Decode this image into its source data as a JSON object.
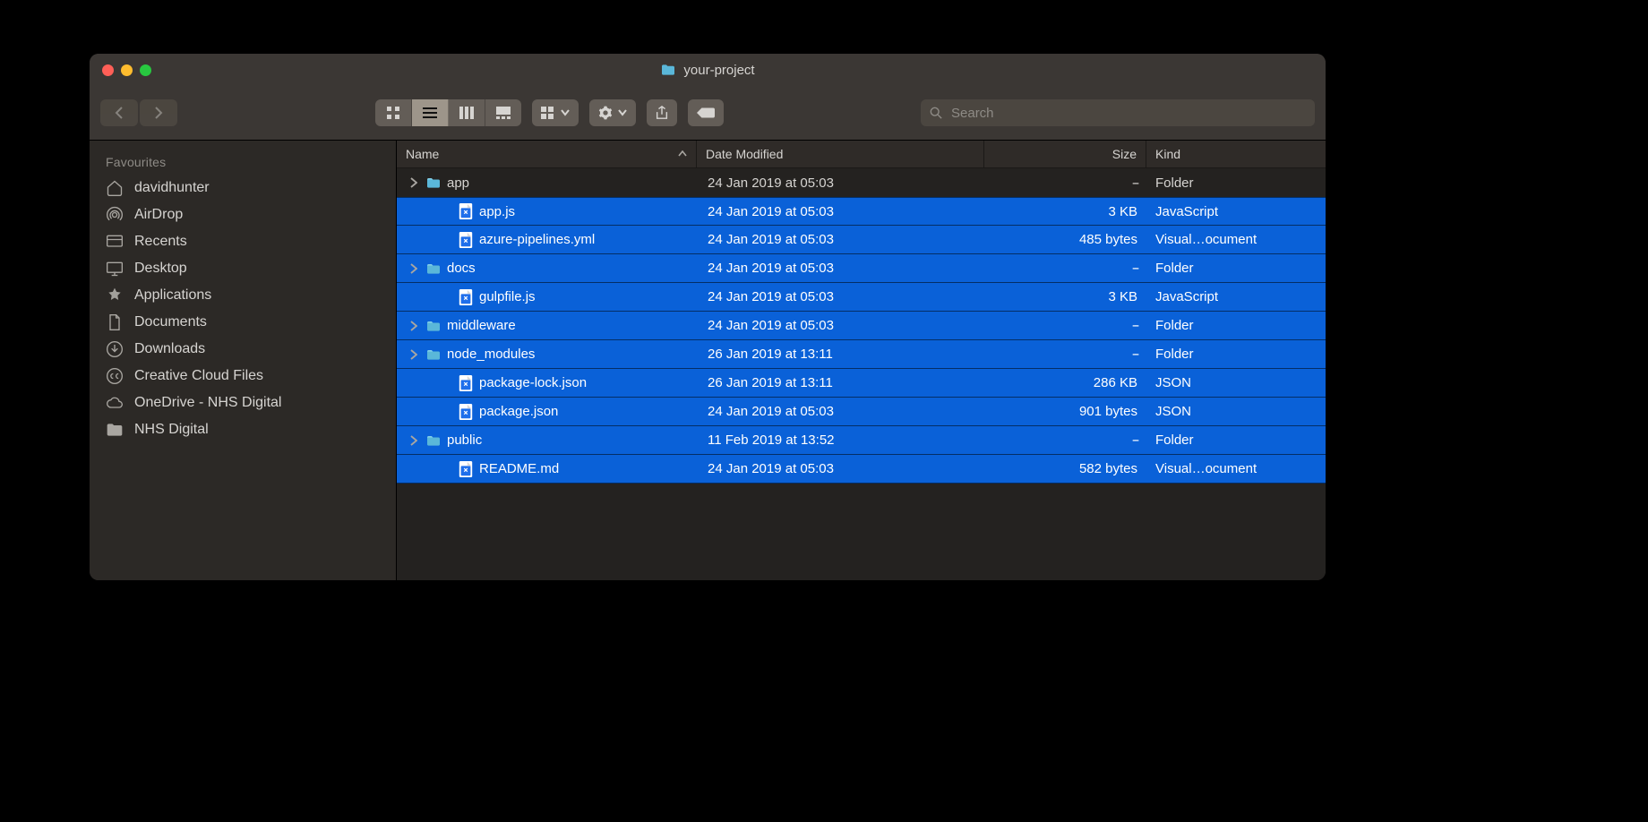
{
  "window": {
    "title": "your-project"
  },
  "toolbar": {
    "search_placeholder": "Search"
  },
  "sidebar": {
    "heading": "Favourites",
    "items": [
      {
        "icon": "home",
        "label": "davidhunter"
      },
      {
        "icon": "airdrop",
        "label": "AirDrop"
      },
      {
        "icon": "recents",
        "label": "Recents"
      },
      {
        "icon": "desktop",
        "label": "Desktop"
      },
      {
        "icon": "apps",
        "label": "Applications"
      },
      {
        "icon": "docs",
        "label": "Documents"
      },
      {
        "icon": "downloads",
        "label": "Downloads"
      },
      {
        "icon": "cc",
        "label": "Creative Cloud Files"
      },
      {
        "icon": "cloud",
        "label": "OneDrive - NHS Digital"
      },
      {
        "icon": "folder",
        "label": "NHS Digital"
      }
    ]
  },
  "columns": {
    "name": "Name",
    "date": "Date Modified",
    "size": "Size",
    "kind": "Kind"
  },
  "files": [
    {
      "type": "folder",
      "name": "app",
      "date": "24 Jan 2019 at 05:03",
      "size": "--",
      "kind": "Folder",
      "selected": false,
      "expandable": true
    },
    {
      "type": "file",
      "icon": "vscode",
      "name": "app.js",
      "date": "24 Jan 2019 at 05:03",
      "size": "3 KB",
      "kind": "JavaScript",
      "selected": true,
      "indent": true
    },
    {
      "type": "file",
      "icon": "vscode",
      "name": "azure-pipelines.yml",
      "date": "24 Jan 2019 at 05:03",
      "size": "485 bytes",
      "kind": "Visual…ocument",
      "selected": true,
      "indent": true
    },
    {
      "type": "folder",
      "name": "docs",
      "date": "24 Jan 2019 at 05:03",
      "size": "--",
      "kind": "Folder",
      "selected": true,
      "expandable": true
    },
    {
      "type": "file",
      "icon": "vscode",
      "name": "gulpfile.js",
      "date": "24 Jan 2019 at 05:03",
      "size": "3 KB",
      "kind": "JavaScript",
      "selected": true,
      "indent": true
    },
    {
      "type": "folder",
      "name": "middleware",
      "date": "24 Jan 2019 at 05:03",
      "size": "--",
      "kind": "Folder",
      "selected": true,
      "expandable": true
    },
    {
      "type": "folder",
      "name": "node_modules",
      "date": "26 Jan 2019 at 13:11",
      "size": "--",
      "kind": "Folder",
      "selected": true,
      "expandable": true
    },
    {
      "type": "file",
      "icon": "vscode",
      "name": "package-lock.json",
      "date": "26 Jan 2019 at 13:11",
      "size": "286 KB",
      "kind": "JSON",
      "selected": true,
      "indent": true
    },
    {
      "type": "file",
      "icon": "vscode",
      "name": "package.json",
      "date": "24 Jan 2019 at 05:03",
      "size": "901 bytes",
      "kind": "JSON",
      "selected": true,
      "indent": true
    },
    {
      "type": "folder",
      "name": "public",
      "date": "11 Feb 2019 at 13:52",
      "size": "--",
      "kind": "Folder",
      "selected": true,
      "expandable": true
    },
    {
      "type": "file",
      "icon": "vscode",
      "name": "README.md",
      "date": "24 Jan 2019 at 05:03",
      "size": "582 bytes",
      "kind": "Visual…ocument",
      "selected": true,
      "indent": true
    }
  ]
}
